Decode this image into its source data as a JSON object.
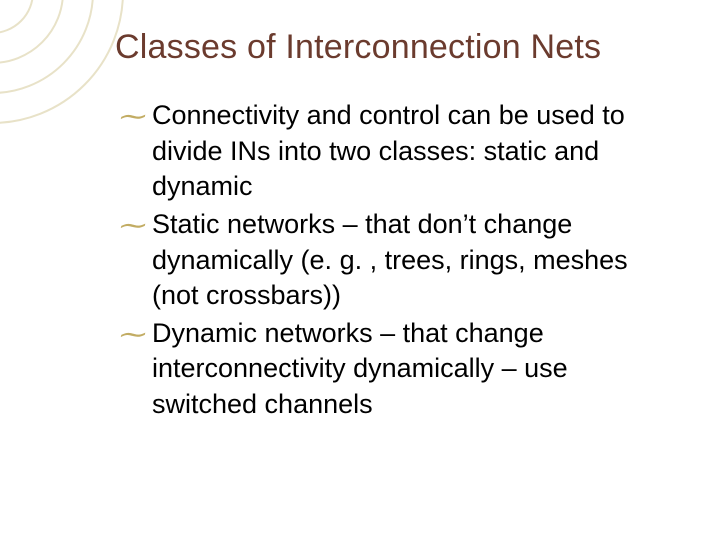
{
  "title": "Classes of Interconnection Nets",
  "bullet_glyph": "་",
  "items": [
    {
      "lead": "Connectivity",
      "rest": " and control can be used to divide INs into two classes: static and dynamic"
    },
    {
      "lead": "Static",
      "rest": " networks – that don’t change dynamically (e. g. , trees, rings, meshes (not crossbars))"
    },
    {
      "lead": "Dynamic",
      "rest": " networks – that change interconnectivity dynamically – use switched channels"
    }
  ]
}
